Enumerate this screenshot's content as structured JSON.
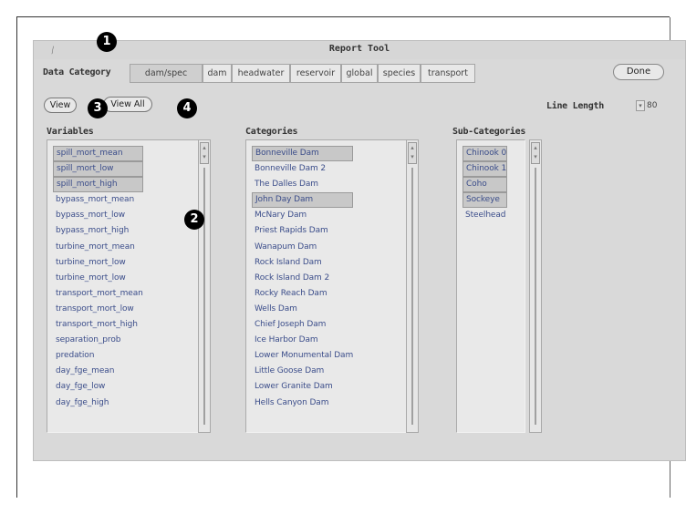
{
  "window": {
    "title": "Report Tool",
    "menu_icon": "window-menu-icon"
  },
  "data_category": {
    "label": "Data Category",
    "tabs": [
      {
        "label": "dam/spec",
        "active": true
      },
      {
        "label": "dam"
      },
      {
        "label": "headwater"
      },
      {
        "label": "reservoir"
      },
      {
        "label": "global"
      },
      {
        "label": "species"
      },
      {
        "label": "transport"
      }
    ]
  },
  "toolbar": {
    "done_label": "Done",
    "view_label": "View",
    "view_all_label": "View All"
  },
  "line_length": {
    "label": "Line Length",
    "value": "80"
  },
  "variables": {
    "heading": "Variables",
    "items": [
      {
        "label": "spill_mort_mean",
        "selected": true
      },
      {
        "label": "spill_mort_low",
        "selected": true
      },
      {
        "label": "spill_mort_high",
        "selected": true
      },
      {
        "label": "bypass_mort_mean"
      },
      {
        "label": "bypass_mort_low"
      },
      {
        "label": "bypass_mort_high"
      },
      {
        "label": "turbine_mort_mean"
      },
      {
        "label": "turbine_mort_low"
      },
      {
        "label": "turbine_mort_low"
      },
      {
        "label": "transport_mort_mean"
      },
      {
        "label": "transport_mort_low"
      },
      {
        "label": "transport_mort_high"
      },
      {
        "label": "separation_prob"
      },
      {
        "label": "predation"
      },
      {
        "label": "day_fge_mean"
      },
      {
        "label": "day_fge_low"
      },
      {
        "label": "day_fge_high"
      }
    ]
  },
  "categories": {
    "heading": "Categories",
    "items": [
      {
        "label": "Bonneville Dam",
        "selected": true
      },
      {
        "label": "Bonneville Dam 2"
      },
      {
        "label": "The Dalles Dam"
      },
      {
        "label": "John Day Dam",
        "selected": true
      },
      {
        "label": "McNary Dam"
      },
      {
        "label": "Priest Rapids Dam"
      },
      {
        "label": "Wanapum Dam"
      },
      {
        "label": "Rock Island Dam"
      },
      {
        "label": "Rock Island Dam 2"
      },
      {
        "label": "Rocky Reach Dam"
      },
      {
        "label": "Wells Dam"
      },
      {
        "label": "Chief Joseph Dam"
      },
      {
        "label": "Ice Harbor Dam"
      },
      {
        "label": "Lower Monumental Dam"
      },
      {
        "label": "Little Goose Dam"
      },
      {
        "label": "Lower Granite Dam"
      },
      {
        "label": "Hells Canyon Dam"
      }
    ]
  },
  "subcategories": {
    "heading": "Sub-Categories",
    "items": [
      {
        "label": "Chinook 0",
        "selected": true
      },
      {
        "label": "Chinook 1",
        "selected": true
      },
      {
        "label": "Coho",
        "selected": true
      },
      {
        "label": "Sockeye",
        "selected": true
      },
      {
        "label": "Steelhead"
      }
    ]
  },
  "annotations": [
    "1",
    "2",
    "3",
    "4"
  ],
  "colors": {
    "window_bg": "#d9d9d9",
    "list_text": "#3b4d8a",
    "marker": "#000000"
  }
}
